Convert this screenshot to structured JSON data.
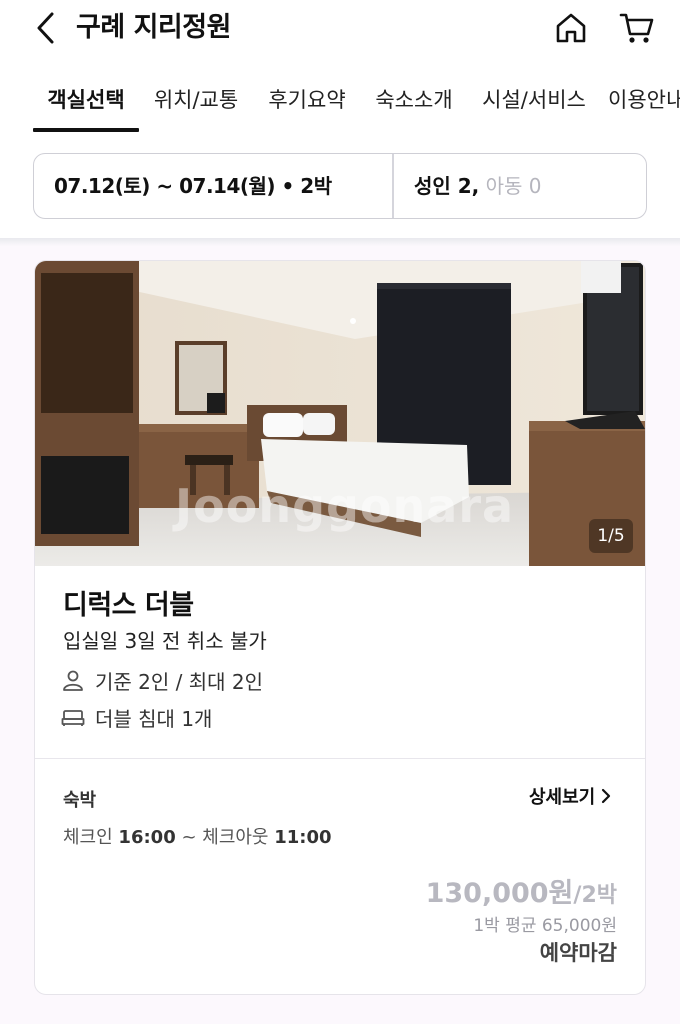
{
  "header": {
    "title": "구례 지리정원",
    "icons": {
      "back": "chevron-left-icon",
      "home": "home-icon",
      "cart": "cart-icon"
    }
  },
  "tabs": [
    {
      "label": "객실선택",
      "active": true
    },
    {
      "label": "위치/교통",
      "active": false
    },
    {
      "label": "후기요약",
      "active": false
    },
    {
      "label": "숙소소개",
      "active": false
    },
    {
      "label": "시설/서비스",
      "active": false
    },
    {
      "label": "이용안내",
      "active": false
    }
  ],
  "search": {
    "dates": "07.12(토) ~ 07.14(월) • 2박",
    "adults": "성인 2,",
    "children": "아동 0"
  },
  "room": {
    "photo_counter": "1/5",
    "watermark": "Joonggonara",
    "name": "디럭스 더블",
    "policy": "입실일 3일 전 취소 불가",
    "occupancy": "기준 2인 / 최대 2인",
    "bed": "더블 침대 1개",
    "stay_label": "숙박",
    "detail_link": "상세보기",
    "checkin_label": "체크인",
    "checkin_time": "16:00",
    "checkout_label": "~ 체크아웃",
    "checkout_time": "11:00",
    "price": "130,000원",
    "price_unit": "/2박",
    "avg_price": "1박 평균 65,000원",
    "status": "예약마감"
  },
  "colors": {
    "accent": "#111111",
    "muted_price": "#b8b8c0",
    "page_bg": "#fcf8fd",
    "border": "#cfcfd6"
  }
}
